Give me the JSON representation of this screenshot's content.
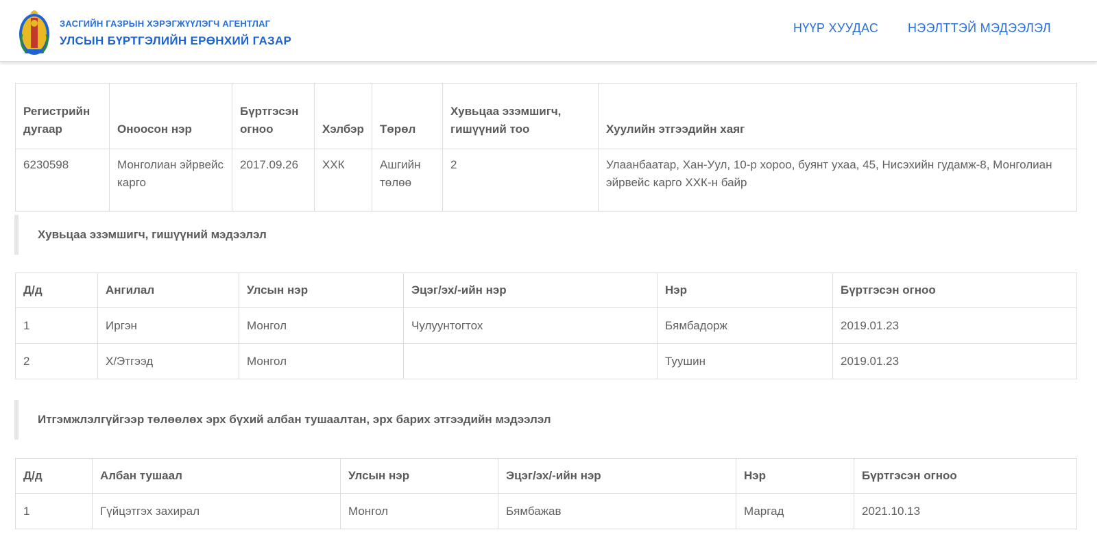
{
  "header": {
    "agency_line1": "ЗАСГИЙН ГАЗРЫН ХЭРЭГЖҮҮЛЭГЧ АГЕНТЛАГ",
    "agency_line2": "УЛСЫН БҮРТГЭЛИЙН ЕРӨНХИЙ ГАЗАР",
    "logo_icon": "mongolian-soyombo-emblem-icon",
    "nav": {
      "home": "НҮҮР ХУУДАС",
      "public_info": "НЭЭЛТТЭЙ МЭДЭЭЛЭЛ"
    },
    "colors": {
      "brand_blue": "#2a6fd6",
      "emblem_gold": "#e8b923",
      "emblem_blue": "#1e63d0"
    }
  },
  "entity_table": {
    "headers": {
      "reg_no": "Регистрийн дугаар",
      "name": "Оноосон нэр",
      "reg_date": "Бүртгэсэн огноо",
      "form": "Хэлбэр",
      "type": "Төрөл",
      "shareholder_count": "Хувьцаа эзэмшигч, гишүүний тоо",
      "address": "Хуулийн этгээдийн хаяг"
    },
    "row": {
      "reg_no": "6230598",
      "name": "Монголиан эйрвейс карго",
      "reg_date": "2017.09.26",
      "form": "ХХК",
      "type": "Ашгийн төлөө",
      "shareholder_count": "2",
      "address": "Улаанбаатар, Хан-Уул, 10-р хороо, буянт ухаа, 45, Нисэхийн гудамж-8, Монголиан эйрвейс карго ХХК-н байр"
    }
  },
  "members_section": {
    "title": "Хувьцаа эзэмшигч, гишүүний мэдээлэл",
    "headers": {
      "no": "Д/д",
      "category": "Ангилал",
      "nationality": "Улсын нэр",
      "parent_name": "Эцэг/эх/-ийн нэр",
      "name": "Нэр",
      "reg_date": "Бүртгэсэн огноо"
    },
    "rows": [
      {
        "no": "1",
        "category": "Иргэн",
        "nationality": "Монгол",
        "parent_name": "Чулуунтогтох",
        "name": "Бямбадорж",
        "reg_date": "2019.01.23"
      },
      {
        "no": "2",
        "category": "Х/Этгээд",
        "nationality": "Монгол",
        "parent_name": "",
        "name": "Туушин",
        "reg_date": "2019.01.23"
      }
    ]
  },
  "officers_section": {
    "title": "Итгэмжлэлгүйгээр төлөөлөх эрх бүхий албан тушаалтан, эрх барих этгээдийн мэдээлэл",
    "headers": {
      "no": "Д/д",
      "position": "Албан тушаал",
      "nationality": "Улсын нэр",
      "parent_name": "Эцэг/эх/-ийн нэр",
      "name": "Нэр",
      "reg_date": "Бүртгэсэн огноо"
    },
    "rows": [
      {
        "no": "1",
        "position": "Гүйцэтгэх захирал",
        "nationality": "Монгол",
        "parent_name": "Бямбажав",
        "name": "Маргад",
        "reg_date": "2021.10.13"
      }
    ]
  }
}
